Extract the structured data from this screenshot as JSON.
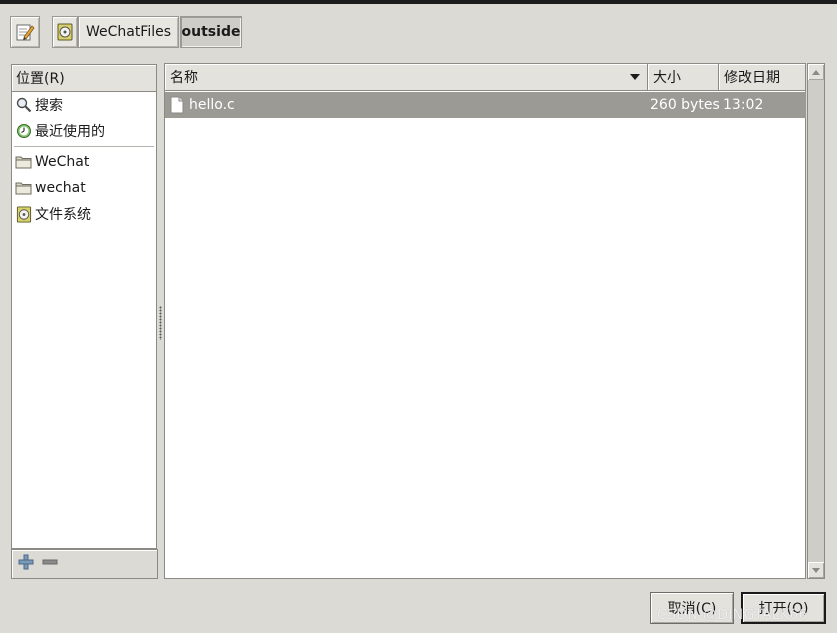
{
  "path_bar": {
    "edit_icon": "pencil-notepad-icon",
    "home_icon": "filesystem-icon",
    "crumbs": [
      "WeChatFiles",
      "outside"
    ]
  },
  "places": {
    "header": "位置(R)",
    "items": [
      {
        "label": "搜索",
        "icon": "search-icon"
      },
      {
        "label": "最近使用的",
        "icon": "recent-icon"
      },
      {
        "label": "WeChat",
        "icon": "folder-icon"
      },
      {
        "label": "wechat",
        "icon": "folder-icon"
      },
      {
        "label": "文件系统",
        "icon": "filesystem-icon"
      }
    ],
    "add_symbol": "+",
    "remove_symbol": "−"
  },
  "files": {
    "columns": {
      "name": "名称",
      "size": "大小",
      "date": "修改日期"
    },
    "rows": [
      {
        "name": "hello.c",
        "size": "260 bytes",
        "date": "13:02",
        "icon": "text-file-icon"
      }
    ]
  },
  "buttons": {
    "cancel": "取消(C)",
    "open": "打开(O)"
  },
  "watermark": "CSDN @DINGTALK66",
  "colors": {
    "selection": "#9c9a95",
    "background": "#dcdad5"
  }
}
